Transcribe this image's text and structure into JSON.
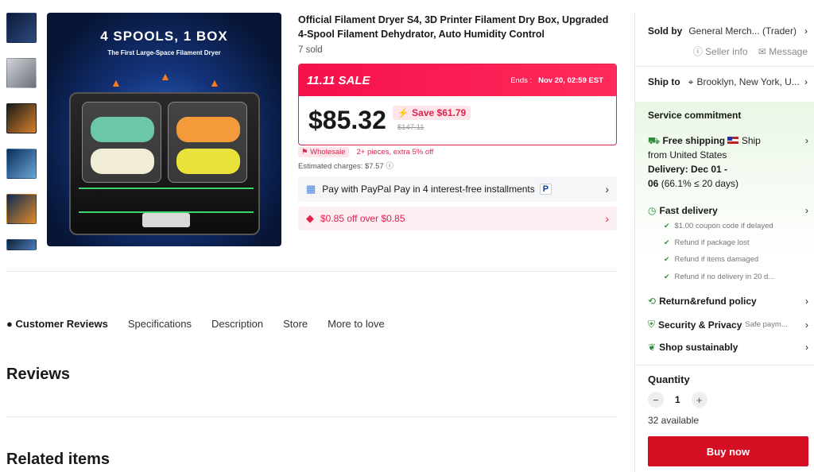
{
  "product": {
    "title": "Official Filament Dryer S4, 3D Printer Filament Dry Box, Upgraded 4-Spool Filament Dehydrator, Auto Humidity Control",
    "sold": "7 sold",
    "hero_title": "4 SPOOLS, 1 BOX",
    "hero_subtitle": "The First Large-Space Filament Dryer",
    "hero_panel_brand": "SUNLU"
  },
  "sale": {
    "label": "11.11 SALE",
    "ends_label": "Ends :",
    "ends_time": "Nov 20, 02:59 EST",
    "price": "$85.32",
    "save": "Save $61.79",
    "original": "$147.11",
    "wholesale_tag": "Wholesale",
    "wholesale_text": "2+ pieces, extra 5% off",
    "estimated": "Estimated charges: $7.57"
  },
  "paypal": {
    "text": "Pay with PayPal Pay in 4 interest-free installments",
    "badge": "P"
  },
  "coupon": {
    "text": "$0.85 off over $0.85"
  },
  "tabs": [
    "Customer Reviews",
    "Specifications",
    "Description",
    "Store",
    "More to love"
  ],
  "sections": {
    "reviews": "Reviews",
    "related": "Related items"
  },
  "side": {
    "sold_by_label": "Sold by",
    "sold_by_value": "General Merch... (Trader)",
    "seller_info": "Seller info",
    "message": "Message",
    "ship_to_label": "Ship to",
    "ship_to_value": "Brooklyn, New York, U...",
    "service_title": "Service commitment",
    "free_shipping": "Free shipping",
    "ship_word": "Ship",
    "ship_from": "from United States",
    "delivery_label": "Delivery: Dec 01 -",
    "delivery_end": "06",
    "delivery_stat": "(66.1% ≤ 20 days)",
    "fast_delivery": "Fast delivery",
    "fast_items": [
      "$1.00 coupon code if delayed",
      "Refund if package lost",
      "Refund if items damaged",
      "Refund if no delivery in 20 d..."
    ],
    "return_policy": "Return&refund policy",
    "security": "Security & Privacy",
    "security_sub": "Safe paym...",
    "sustainable": "Shop sustainably",
    "quantity_label": "Quantity",
    "quantity_value": "1",
    "available": "32 available",
    "buy_now": "Buy now"
  },
  "colors": {
    "accent": "#e0224f",
    "buy": "#d40f24",
    "green": "#2e8b3c"
  }
}
